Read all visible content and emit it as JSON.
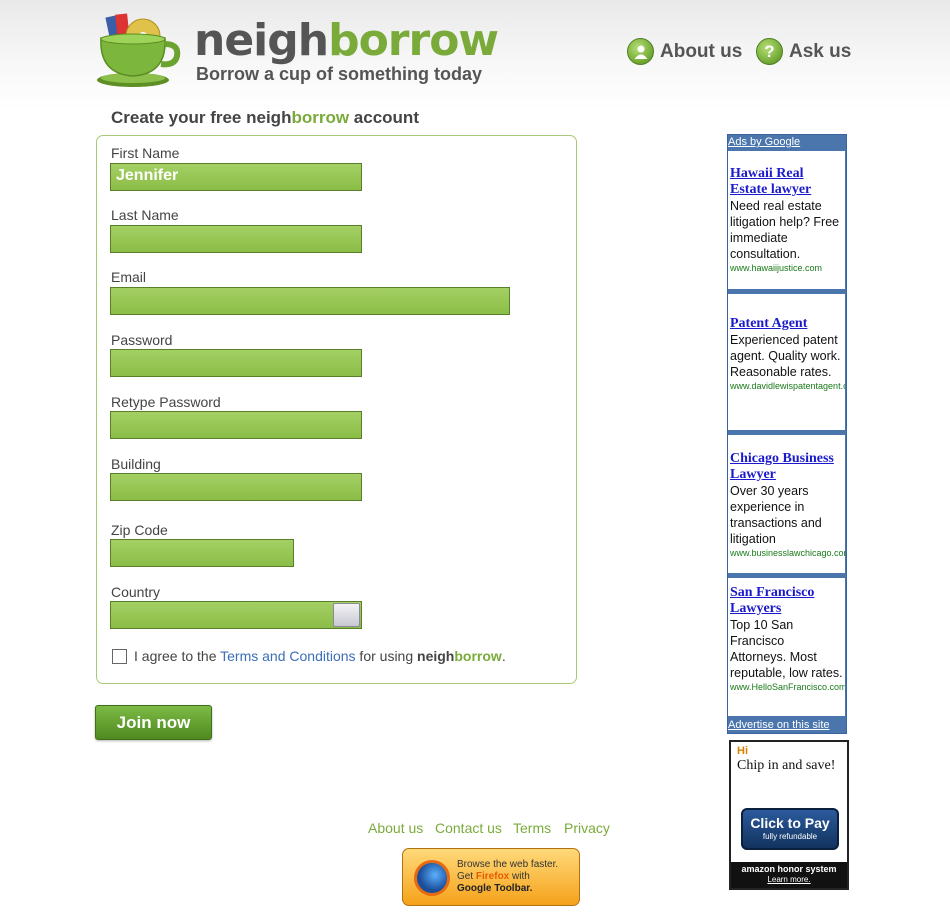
{
  "brand": {
    "name_part1": "neigh",
    "name_part2": "borrow",
    "tagline": "Borrow a cup of something today"
  },
  "header_nav": {
    "about_label": "About us",
    "ask_label": "Ask us",
    "about_icon": "person-icon",
    "ask_icon": "question-icon"
  },
  "form": {
    "title_before": "Create your free ",
    "title_neigh": "neigh",
    "title_borrow": "borrow",
    "title_after": " account",
    "first_name_label": "First Name",
    "first_name_value": "Jennifer",
    "last_name_label": "Last Name",
    "last_name_value": "",
    "email_label": "Email",
    "email_value": "",
    "password_label": "Password",
    "password_value": "",
    "retype_password_label": "Retype Password",
    "retype_password_value": "",
    "building_label": "Building",
    "building_value": "",
    "zip_label": "Zip Code",
    "zip_value": "",
    "country_label": "Country",
    "country_value": "",
    "agree_before": "I agree to the ",
    "agree_link": "Terms and Conditions",
    "agree_middle": " for using ",
    "agree_neigh": "neigh",
    "agree_borrow": "borrow",
    "agree_end": ".",
    "agree_checked": false,
    "submit_label": "Join now"
  },
  "footer": {
    "links": [
      "About us",
      "Contact us",
      "Terms",
      "Privacy"
    ],
    "firefox_line1": "Browse the web faster.",
    "firefox_get": "Get ",
    "firefox_name": "Firefox",
    "firefox_with": " with",
    "firefox_line3": "Google Toolbar."
  },
  "ads": {
    "header": "Ads by Google",
    "footer": "Advertise on this site",
    "items": [
      {
        "title": "Hawaii Real Estate lawyer",
        "body": "Need real estate litigation help? Free immediate consultation.",
        "url": "www.hawaiijustice.com"
      },
      {
        "title": "Patent Agent",
        "body": "Experienced patent agent. Quality work. Reasonable rates.",
        "url": "www.davidlewispatentagent.com"
      },
      {
        "title": "Chicago Business Lawyer",
        "body": "Over 30 years experience in transactions and litigation",
        "url": "www.businesslawchicago.com"
      },
      {
        "title": "San Francisco Lawyers",
        "body": "Top 10 San Francisco Attorneys. Most reputable, low rates.",
        "url": "www.HelloSanFrancisco.com"
      }
    ]
  },
  "amazon": {
    "hi": "Hi",
    "chip": "Chip in and save!",
    "pay_title": "Click to Pay",
    "pay_sub": "fully refundable",
    "honor": "amazon honor system",
    "learn": "Learn more."
  },
  "colors": {
    "brand_green": "#7aab3a",
    "field_green": "#8cbd47",
    "link_blue": "#3b6db8",
    "ad_blue": "#4a76ad"
  }
}
